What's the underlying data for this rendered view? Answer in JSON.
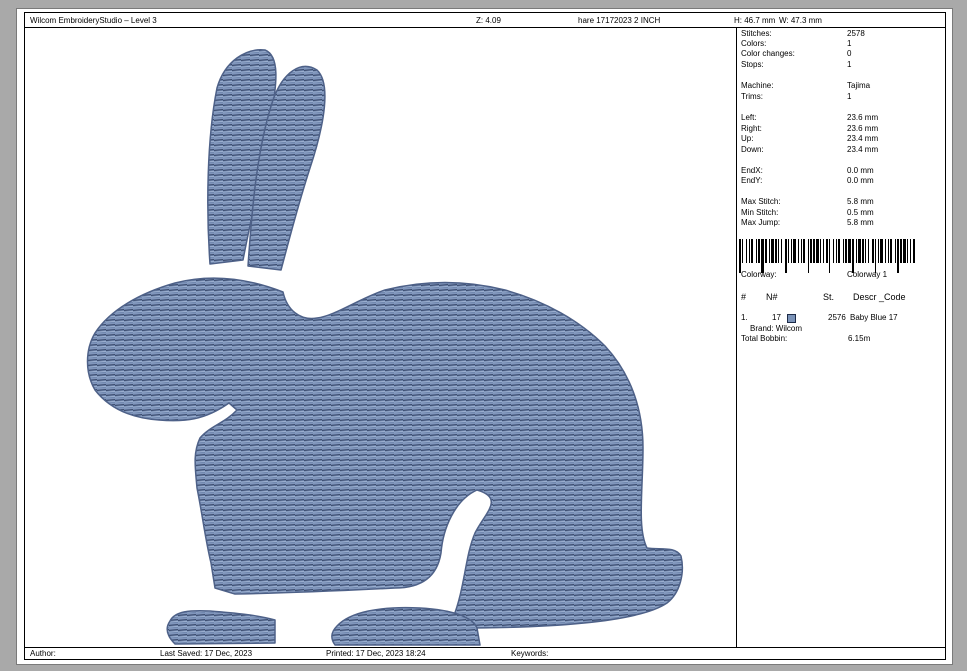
{
  "header": {
    "app": "Wilcom EmbroideryStudio – Level 3",
    "zoom": "Z: 4.09",
    "file": "hare 17172023 2 INCH",
    "height": "H: 46.7 mm",
    "width": "W: 47.3 mm"
  },
  "footer": {
    "author": "Author:",
    "last_saved": "Last Saved: 17 Dec, 2023",
    "printed": "Printed: 17 Dec, 2023 18:24",
    "keywords": "Keywords:"
  },
  "stats": [
    {
      "label": "Stitches:",
      "value": "2578"
    },
    {
      "label": "Colors:",
      "value": "1"
    },
    {
      "label": "Color changes:",
      "value": "0"
    },
    {
      "label": "Stops:",
      "value": "1"
    },
    {
      "label": "Machine:",
      "value": "Tajima"
    },
    {
      "label": "Trims:",
      "value": "1"
    },
    {
      "label": "Left:",
      "value": "23.6 mm"
    },
    {
      "label": "Right:",
      "value": "23.6 mm"
    },
    {
      "label": "Up:",
      "value": "23.4 mm"
    },
    {
      "label": "Down:",
      "value": "23.4 mm"
    },
    {
      "label": "EndX:",
      "value": "0.0 mm"
    },
    {
      "label": "EndY:",
      "value": "0.0 mm"
    },
    {
      "label": "Max Stitch:",
      "value": "5.8 mm"
    },
    {
      "label": "Min Stitch:",
      "value": "0.5 mm"
    },
    {
      "label": "Max Jump:",
      "value": "5.8 mm"
    }
  ],
  "colorway": {
    "label": "Colorway:",
    "value": "Colorway 1"
  },
  "table": {
    "headers": [
      "#",
      "N#",
      "St.",
      "Descr _Code"
    ],
    "row": {
      "index": "1.",
      "needle": "17",
      "stitches": "2576",
      "description": "Baby Blue 17",
      "swatch_color": "#7b93b8"
    },
    "brand": "Brand: Wilcom"
  },
  "bobbin": {
    "label": "Total Bobbin:",
    "value": "6.15m"
  },
  "design": {
    "thread_color": "#7b93b8"
  }
}
